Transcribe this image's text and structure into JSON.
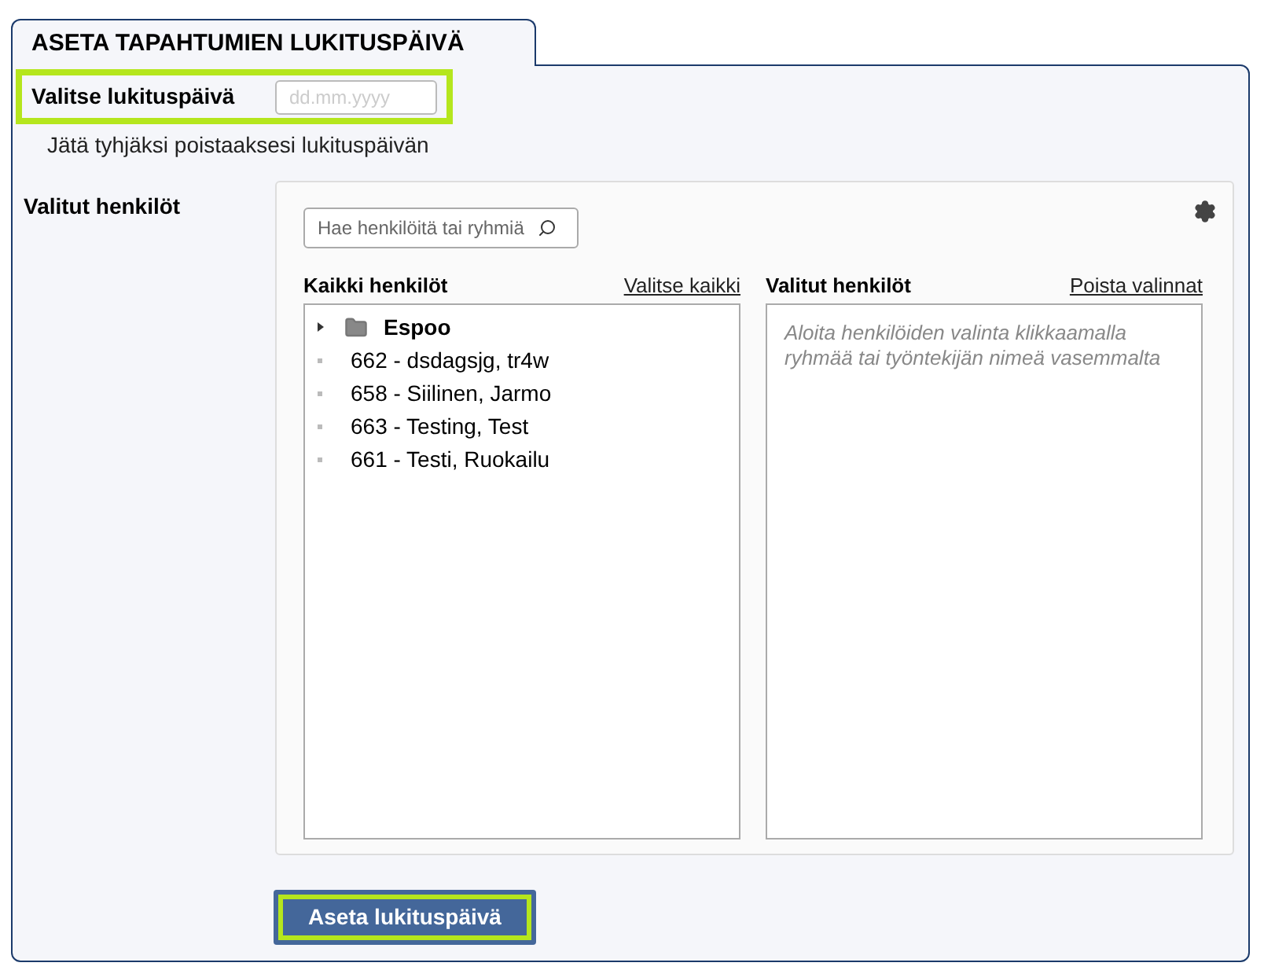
{
  "tab": {
    "label": "ASETA TAPAHTUMIEN LUKITUSPÄIVÄ",
    "selected": true
  },
  "date_field": {
    "label": "Valitse lukituspäivä",
    "placeholder": "dd.mm.yyyy",
    "highlighted": true,
    "hint": "Jätä tyhjäksi poistaaksesi lukituspäivän"
  },
  "people_label": "Valitut henkilöt",
  "search": {
    "placeholder": "Hae henkilöitä tai ryhmiä"
  },
  "all_people": {
    "title": "Kaikki henkilöt",
    "link": "Valitse kaikki",
    "items": [
      {
        "kind": "group",
        "label": "Espoo",
        "expanded": false
      },
      {
        "kind": "person",
        "label": "662 - dsdagsjg, tr4w"
      },
      {
        "kind": "person",
        "label": "658 - Siilinen, Jarmo"
      },
      {
        "kind": "person",
        "label": "663 - Testing, Test"
      },
      {
        "kind": "person",
        "label": "661 - Testi, Ruokailu"
      }
    ]
  },
  "selected_people": {
    "title": "Valitut henkilöt",
    "link": "Poista valinnat",
    "empty_text": "Aloita henkilöiden valinta klikkaamalla ryhmää tai työntekijän nimeä vasemmalta"
  },
  "submit": {
    "label": "Aseta lukituspäivä",
    "highlighted": true
  }
}
